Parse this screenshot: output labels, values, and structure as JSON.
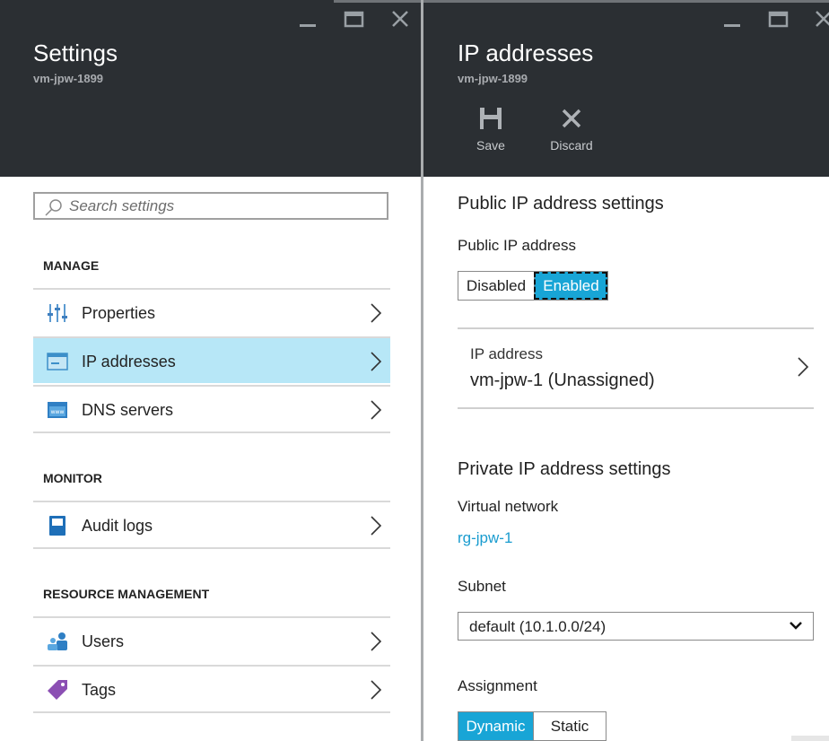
{
  "left_blade": {
    "title": "Settings",
    "subtitle": "vm-jpw-1899",
    "search": {
      "placeholder": "Search settings",
      "value": ""
    },
    "sections": [
      {
        "label": "MANAGE",
        "items": [
          {
            "label": "Properties",
            "icon": "properties-sliders-icon",
            "selected": false
          },
          {
            "label": "IP addresses",
            "icon": "ip-address-card-icon",
            "selected": true
          },
          {
            "label": "DNS servers",
            "icon": "dns-www-icon",
            "selected": false
          }
        ]
      },
      {
        "label": "MONITOR",
        "items": [
          {
            "label": "Audit logs",
            "icon": "audit-log-book-icon",
            "selected": false
          }
        ]
      },
      {
        "label": "RESOURCE MANAGEMENT",
        "items": [
          {
            "label": "Users",
            "icon": "users-icon",
            "selected": false
          },
          {
            "label": "Tags",
            "icon": "tag-icon",
            "selected": false
          }
        ]
      }
    ]
  },
  "right_blade": {
    "title": "IP addresses",
    "subtitle": "vm-jpw-1899",
    "commands": {
      "save": "Save",
      "discard": "Discard"
    },
    "public_section": {
      "heading": "Public IP address settings",
      "toggle_label": "Public IP address",
      "toggle_options": [
        "Disabled",
        "Enabled"
      ],
      "toggle_selected": "Enabled",
      "ip_address_label": "IP address",
      "ip_address_value": "vm-jpw-1 (Unassigned)"
    },
    "private_section": {
      "heading": "Private IP address settings",
      "vnet_label": "Virtual network",
      "vnet_value": "rg-jpw-1",
      "subnet_label": "Subnet",
      "subnet_value": "default (10.1.0.0/24)",
      "assignment_label": "Assignment",
      "assignment_options": [
        "Dynamic",
        "Static"
      ],
      "assignment_selected": "Dynamic"
    }
  },
  "colors": {
    "header_bg": "#2b2f33",
    "selected_row": "#b7e7f7",
    "accent": "#18a5d6",
    "link": "#1a9ccf"
  }
}
